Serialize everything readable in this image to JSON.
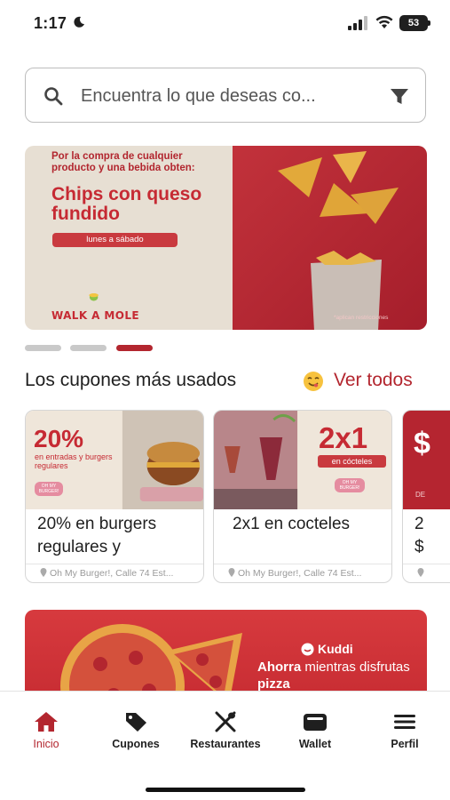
{
  "status": {
    "time": "1:17",
    "battery": "53"
  },
  "search": {
    "placeholder": "Encuentra lo que deseas co..."
  },
  "hero": {
    "text": "Por la compra de cualquier producto y una bebida obten:",
    "title": "Chips con queso fundido",
    "pill": "lunes a sábado",
    "brand": "WALK A MOLE",
    "disclaimer": "*aplican restricciones"
  },
  "carousel": {
    "count": 3,
    "active_index": 2
  },
  "section": {
    "title": "Los cupones más usados",
    "link": "Ver todos"
  },
  "coupons": [
    {
      "title": "20% en burgers regulares y",
      "location": "Oh My Burger!, Calle 74 Est...",
      "badge": "20%",
      "sub": "en entradas y burgers regulares",
      "brand": "OH MY BURGER!"
    },
    {
      "title": "2x1 en cocteles",
      "location": "Oh My Burger!, Calle 74 Est...",
      "badge": "2x1",
      "sub": "en cócteles",
      "brand": "OH MY BURGER!"
    },
    {
      "title": "2",
      "title2": "$",
      "location": "",
      "badge": "$",
      "sub": "DE"
    }
  ],
  "banner2": {
    "brand": "Kuddi",
    "headline_bold": "Ahorra",
    "headline_rest": " mientras disfrutas ",
    "headline_tail": "pizza"
  },
  "tabs": [
    {
      "label": "Inicio",
      "icon": "home-icon",
      "active": true
    },
    {
      "label": "Cupones",
      "icon": "coupon-tag-icon",
      "active": false
    },
    {
      "label": "Restaurantes",
      "icon": "fork-knife-icon",
      "active": false
    },
    {
      "label": "Wallet",
      "icon": "wallet-icon",
      "active": false
    },
    {
      "label": "Perfil",
      "icon": "menu-icon",
      "active": false
    }
  ],
  "colors": {
    "accent": "#b3262f",
    "banner_red": "#c82d33",
    "cream": "#e7dfd3"
  }
}
